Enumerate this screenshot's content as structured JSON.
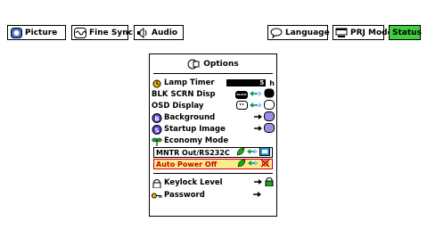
{
  "tabs": [
    {
      "label": "Picture",
      "icon": "picture-icon",
      "active": false
    },
    {
      "label": "Fine Sync",
      "icon": "fine-sync-icon",
      "active": false
    },
    {
      "label": "Audio",
      "icon": "speaker-icon",
      "active": false
    },
    {
      "label": "Language",
      "icon": "speech-bubble-icon",
      "active": false
    },
    {
      "label": "PRJ Mode",
      "icon": "projector-icon",
      "active": false
    },
    {
      "label": "Status",
      "icon": "",
      "active": true
    }
  ],
  "options": {
    "title": "Options",
    "lamp_timer": {
      "label": "Lamp Timer",
      "value": "5",
      "unit": "h"
    },
    "blk_scrn": {
      "label": "BLK SCRN Disp",
      "badge": "BLACK"
    },
    "osd": {
      "label": "OSD Display"
    },
    "background": {
      "label": "Background",
      "badge": "B"
    },
    "startup": {
      "label": "Startup Image",
      "badge": "S"
    },
    "economy": {
      "label": "Economy Mode"
    },
    "mntr": {
      "label": "MNTR Out/RS232C"
    },
    "auto_power": {
      "label": "Auto Power Off"
    },
    "keylock": {
      "label": "Keylock Level"
    },
    "password": {
      "label": "Password"
    }
  },
  "colors": {
    "active_tab": "#3fcf3f",
    "highlight_bg": "#ffe98a",
    "highlight_text": "#c4000d",
    "leaf_green": "#18a418",
    "arrow_cyan": "#2a9ad8",
    "icon_purple": "#5a3ccf"
  }
}
